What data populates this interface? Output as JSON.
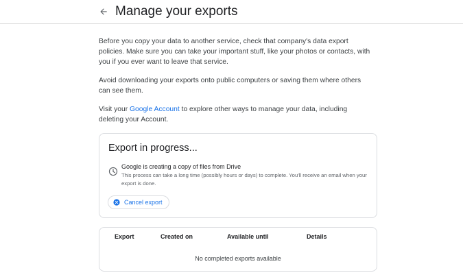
{
  "header": {
    "back_icon": "arrow-back-icon",
    "title": "Manage your exports"
  },
  "intro": {
    "p1": "Before you copy your data to another service, check that company's data export policies. Make sure you can take your important stuff, like your photos or contacts, with you if you ever want to leave that service.",
    "p2": "Avoid downloading your exports onto public computers or saving them where others can see them.",
    "p3_before": "Visit your ",
    "p3_link": "Google Account",
    "p3_after": " to explore other ways to manage your data, including deleting your Account."
  },
  "progress_card": {
    "title": "Export in progress...",
    "status_icon": "clock-icon",
    "status_title": "Google is creating a copy of files from Drive",
    "status_desc": "This process can take a long time (possibly hours or days) to complete. You'll receive an email when your export is done.",
    "cancel_icon": "cancel-circle-icon",
    "cancel_label": "Cancel export"
  },
  "exports_table": {
    "columns": [
      "Export",
      "Created on",
      "Available until",
      "Details"
    ],
    "empty_message": "No completed exports available"
  },
  "colors": {
    "link": "#1a73e8",
    "border": "#dadce0",
    "text": "#202124",
    "secondary_text": "#5f6368"
  }
}
